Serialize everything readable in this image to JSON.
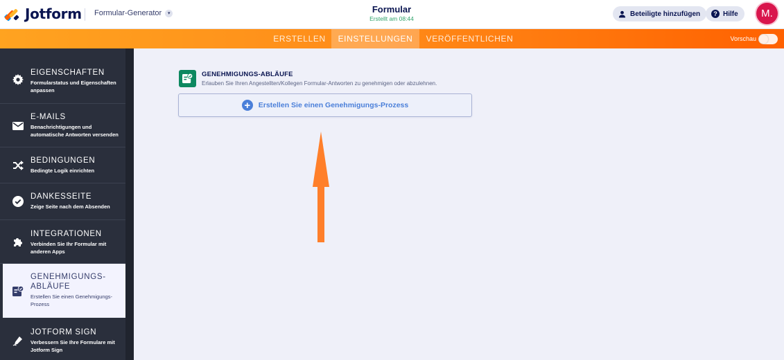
{
  "header": {
    "brand": "Jotform",
    "form_generator": "Formular-Generator",
    "title": "Formular",
    "subtitle": "Erstellt am 08:44",
    "collab_button": "Beteiligte hinzufügen",
    "help_button": "Hilfe",
    "avatar_initial": "M."
  },
  "nav": {
    "tabs": [
      {
        "label": "ERSTELLEN"
      },
      {
        "label": "EINSTELLUNGEN",
        "active": true
      },
      {
        "label": "VERÖFFENTLICHEN"
      }
    ],
    "preview_label": "Vorschau",
    "preview_on": false
  },
  "sidebar": {
    "items": [
      {
        "title": "EIGENSCHAFTEN",
        "desc": "Formularstatus und Eigenschaften anpassen",
        "icon": "gear-icon"
      },
      {
        "title": "E-MAILS",
        "desc": "Benachrichtigungen und automatische Antworten versenden",
        "icon": "envelope-icon"
      },
      {
        "title": "BEDINGUNGEN",
        "desc": "Bedingte Logik einrichten",
        "icon": "shuffle-icon"
      },
      {
        "title": "DANKESSEITE",
        "desc": "Zeige Seite nach dem Absenden",
        "icon": "check-circle-icon"
      },
      {
        "title": "INTEGRATIONEN",
        "desc": "Verbinden Sie Ihr Formular mit anderen Apps",
        "icon": "puzzle-icon"
      },
      {
        "title_line1": "GENEHMIGUNGS-",
        "title_line2": "ABLÄUFE",
        "desc": "Erstellen Sie einen Genehmigungs-Prozess",
        "icon": "approval-icon",
        "active": true
      },
      {
        "title": "JOTFORM SIGN",
        "desc": "Verbessern Sie Ihre Formulare mit Jotform Sign",
        "icon": "pen-icon"
      }
    ]
  },
  "main": {
    "section_title": "GENEHMIGUNGS-ABLÄUFE",
    "section_desc": "Erlauben Sie Ihren Angestellten/Kollegen Formular-Antworten zu genehmigen oder abzulehnen.",
    "create_button": "Erstellen Sie einen Genehmigungs-Prozess"
  },
  "colors": {
    "brand_dark": "#0a1551",
    "nav_orange": "#ff8a18",
    "sidebar_bg": "#2a2f3c",
    "approval_green": "#0d8860",
    "link_blue": "#4a7fd9",
    "annotation_arrow": "#ff7f2a",
    "avatar_bg": "#d9164d"
  }
}
